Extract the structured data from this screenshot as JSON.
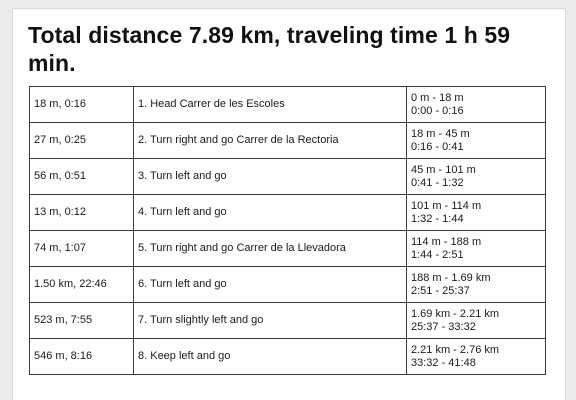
{
  "summary": {
    "title": "Total distance 7.89 km, traveling time 1 h 59 min."
  },
  "steps": [
    {
      "dist_time": "18 m, 0:16",
      "instruction": "1. Head Carrer de les Escoles",
      "range_dist": "0 m - 18 m",
      "range_time": "0:00 - 0:16"
    },
    {
      "dist_time": "27 m, 0:25",
      "instruction": "2. Turn right and go Carrer de la Rectoria",
      "range_dist": "18 m - 45 m",
      "range_time": "0:16 - 0:41"
    },
    {
      "dist_time": "56 m, 0:51",
      "instruction": "3. Turn left and go",
      "range_dist": "45 m - 101 m",
      "range_time": "0:41 - 1:32"
    },
    {
      "dist_time": "13 m, 0:12",
      "instruction": "4. Turn left and go",
      "range_dist": "101 m - 114 m",
      "range_time": "1:32 - 1:44"
    },
    {
      "dist_time": "74 m, 1:07",
      "instruction": "5. Turn right and go Carrer de la Llevadora",
      "range_dist": "114 m - 188 m",
      "range_time": "1:44 - 2:51"
    },
    {
      "dist_time": "1.50 km, 22:46",
      "instruction": "6. Turn left and go",
      "range_dist": "188 m - 1.69 km",
      "range_time": "2:51 - 25:37"
    },
    {
      "dist_time": "523 m, 7:55",
      "instruction": "7. Turn slightly left and go",
      "range_dist": "1.69 km - 2.21 km",
      "range_time": "25:37 - 33:32"
    },
    {
      "dist_time": "546 m, 8:16",
      "instruction": "8. Keep left and go",
      "range_dist": "2.21 km - 2.76 km",
      "range_time": "33:32 - 41:48"
    }
  ]
}
